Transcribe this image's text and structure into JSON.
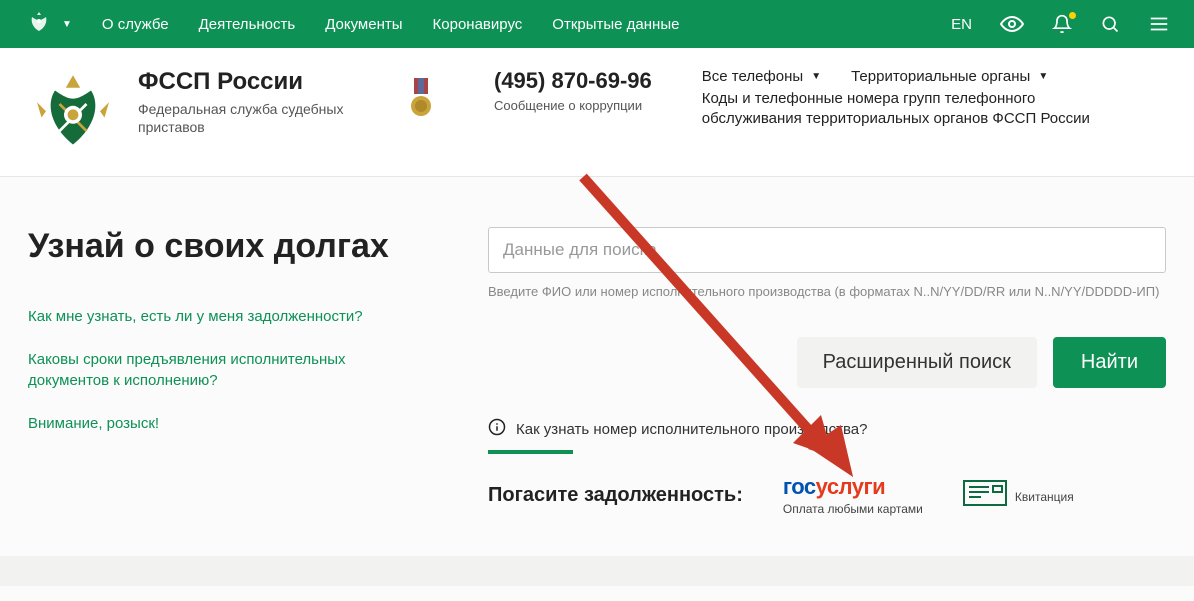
{
  "topbar": {
    "nav": [
      "О службе",
      "Деятельность",
      "Документы",
      "Коронавирус",
      "Открытые данные"
    ],
    "lang": "EN"
  },
  "mainbar": {
    "title": "ФССП России",
    "subtitle": "Федеральная служба судебных приставов",
    "phone": "(495) 870-69-96",
    "phone_sub": "Сообщение о коррупции",
    "right_items": [
      "Все телефоны",
      "Территориальные органы"
    ],
    "right_text": "Коды и телефонные номера групп телефонного обслуживания территориальных органов ФССП России"
  },
  "content": {
    "heading": "Узнай о своих долгах",
    "faq": [
      "Как мне узнать, есть ли у меня задолженности?",
      "Каковы сроки предъявления исполнительных документов к исполнению?",
      "Внимание, розыск!"
    ],
    "search_placeholder": "Данные для поиска",
    "search_hint": "Введите ФИО или номер исполнительного производства (в форматах N..N/YY/DD/RR или N..N/YY/DDDDD-ИП)",
    "advanced_label": "Расширенный поиск",
    "find_label": "Найти",
    "howto": "Как узнать номер исполнительного производства?",
    "pay_title": "Погасите задолженность:",
    "gos_blue": "гос",
    "gos_red": "услуги",
    "gos_sub": "Оплата любыми картами",
    "receipt_label": "Квитанция"
  }
}
